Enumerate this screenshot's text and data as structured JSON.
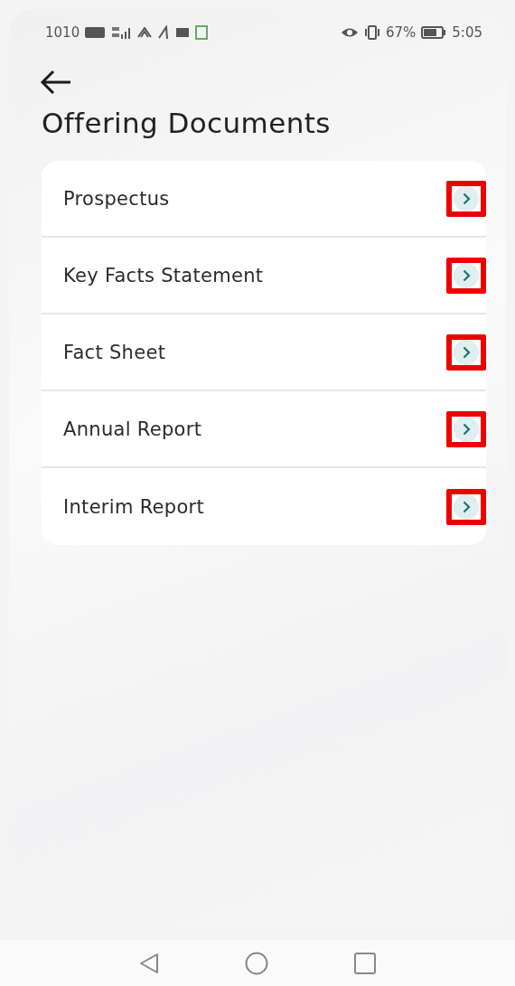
{
  "status_bar": {
    "data_speed": "1010",
    "battery": "67%",
    "time": "5:05"
  },
  "header": {
    "title": "Offering Documents"
  },
  "documents": [
    {
      "label": "Prospectus",
      "highlighted": true
    },
    {
      "label": "Key Facts Statement",
      "highlighted": true
    },
    {
      "label": "Fact Sheet",
      "highlighted": true
    },
    {
      "label": "Annual Report",
      "highlighted": true
    },
    {
      "label": "Interim Report",
      "highlighted": true
    }
  ]
}
